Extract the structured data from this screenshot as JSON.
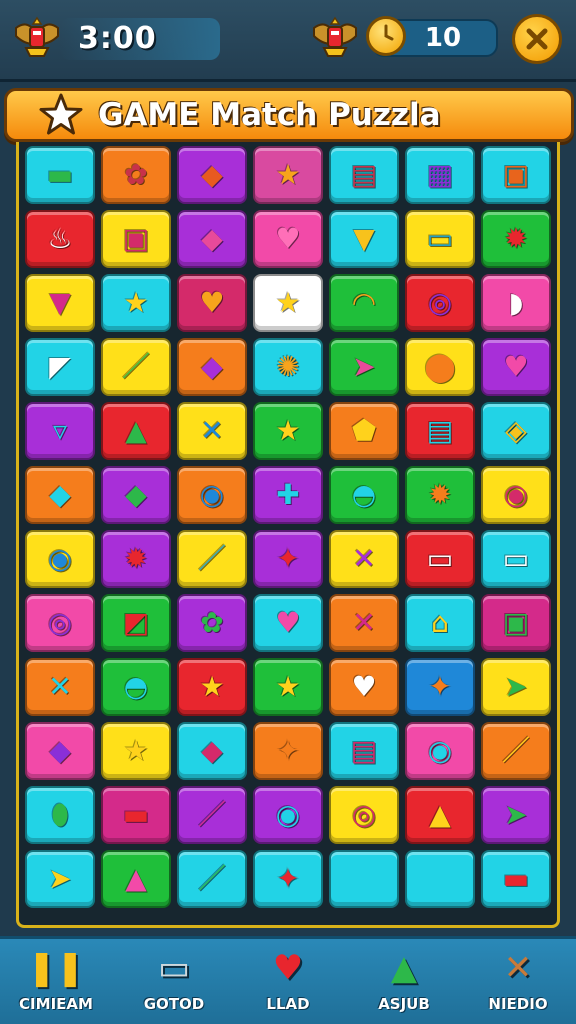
{
  "header": {
    "timer": "3:00",
    "score": "10",
    "title": "GAME Match Puzzla"
  },
  "icons": {
    "left_emblem": "eagle-crest-icon",
    "right_emblem": "eagle-crest-icon",
    "score_icon": "coin-clock-icon",
    "close": "close-x-icon",
    "banner_star": "star-icon"
  },
  "colors": {
    "banner": "#f7a31c",
    "board_border": "#d8b21a",
    "bottom_bar": "#2a89b8",
    "close_button": "#f5b014"
  },
  "board": {
    "rows": 12,
    "cols": 7,
    "tiles": [
      [
        {
          "bg": "#22d3e6",
          "icon": "▬",
          "fg": "#2db84a"
        },
        {
          "bg": "#f57d1c",
          "icon": "✿",
          "fg": "#c8324a"
        },
        {
          "bg": "#a82fd8",
          "icon": "◆",
          "fg": "#e85a20"
        },
        {
          "bg": "#d94aa0",
          "icon": "★",
          "fg": "#f7a41c"
        },
        {
          "bg": "#22d3e6",
          "icon": "▤",
          "fg": "#c8324a"
        },
        {
          "bg": "#22d3e6",
          "icon": "▦",
          "fg": "#8a2fd8"
        },
        {
          "bg": "#22d3e6",
          "icon": "▣",
          "fg": "#e8641c"
        }
      ],
      [
        {
          "bg": "#e8262e",
          "icon": "♨",
          "fg": "#ffffff"
        },
        {
          "bg": "#ffe019",
          "icon": "▣",
          "fg": "#d42a6a"
        },
        {
          "bg": "#a82fd8",
          "icon": "◆",
          "fg": "#e84a9a"
        },
        {
          "bg": "#f24aa8",
          "icon": "♥",
          "fg": "#ff6fb8"
        },
        {
          "bg": "#22d3e6",
          "icon": "▼",
          "fg": "#f7c21c"
        },
        {
          "bg": "#ffe019",
          "icon": "▭",
          "fg": "#1fa0c8"
        },
        {
          "bg": "#1fbf3a",
          "icon": "✹",
          "fg": "#e8262e"
        }
      ],
      [
        {
          "bg": "#ffe019",
          "icon": "▼",
          "fg": "#d42a8a"
        },
        {
          "bg": "#22d3e6",
          "icon": "★",
          "fg": "#ffd21c"
        },
        {
          "bg": "#d42a6a",
          "icon": "♥",
          "fg": "#f7a41c"
        },
        {
          "bg": "#ffffff",
          "icon": "★",
          "fg": "#ffd21c"
        },
        {
          "bg": "#1fbf3a",
          "icon": "◠",
          "fg": "#f7a41c"
        },
        {
          "bg": "#e8262e",
          "icon": "◎",
          "fg": "#8a2fd8"
        },
        {
          "bg": "#f24aa8",
          "icon": "◗",
          "fg": "#ffffff"
        }
      ],
      [
        {
          "bg": "#22d3e6",
          "icon": "◤",
          "fg": "#ffffff"
        },
        {
          "bg": "#ffe019",
          "icon": "／",
          "fg": "#2db84a"
        },
        {
          "bg": "#f57d1c",
          "icon": "◆",
          "fg": "#a82fd8"
        },
        {
          "bg": "#22d3e6",
          "icon": "✺",
          "fg": "#f7a41c"
        },
        {
          "bg": "#1fbf3a",
          "icon": "➤",
          "fg": "#e84a9a"
        },
        {
          "bg": "#ffe019",
          "icon": "⬤",
          "fg": "#f57d1c"
        },
        {
          "bg": "#a82fd8",
          "icon": "♥",
          "fg": "#f24aa8"
        }
      ],
      [
        {
          "bg": "#a82fd8",
          "icon": "▿",
          "fg": "#22d3e6"
        },
        {
          "bg": "#e8262e",
          "icon": "▲",
          "fg": "#2db84a"
        },
        {
          "bg": "#ffe019",
          "icon": "✕",
          "fg": "#1f88d8"
        },
        {
          "bg": "#1fbf3a",
          "icon": "★",
          "fg": "#ffd21c"
        },
        {
          "bg": "#f57d1c",
          "icon": "⬟",
          "fg": "#ffd21c"
        },
        {
          "bg": "#e8262e",
          "icon": "▤",
          "fg": "#22d3e6"
        },
        {
          "bg": "#22d3e6",
          "icon": "◈",
          "fg": "#f7c21c"
        }
      ],
      [
        {
          "bg": "#f57d1c",
          "icon": "◆",
          "fg": "#22d3e6"
        },
        {
          "bg": "#a82fd8",
          "icon": "◆",
          "fg": "#2db84a"
        },
        {
          "bg": "#f57d1c",
          "icon": "◉",
          "fg": "#1f88d8"
        },
        {
          "bg": "#a82fd8",
          "icon": "✚",
          "fg": "#22d3e6"
        },
        {
          "bg": "#1fbf3a",
          "icon": "◓",
          "fg": "#22d3e6"
        },
        {
          "bg": "#1fbf3a",
          "icon": "✹",
          "fg": "#f57d1c"
        },
        {
          "bg": "#ffe019",
          "icon": "◉",
          "fg": "#d42a6a"
        }
      ],
      [
        {
          "bg": "#ffe019",
          "icon": "◉",
          "fg": "#1f88d8"
        },
        {
          "bg": "#a82fd8",
          "icon": "✹",
          "fg": "#e8262e"
        },
        {
          "bg": "#ffe019",
          "icon": "／",
          "fg": "#1fa0c8"
        },
        {
          "bg": "#a82fd8",
          "icon": "✦",
          "fg": "#e8262e"
        },
        {
          "bg": "#ffe019",
          "icon": "✕",
          "fg": "#a82fd8"
        },
        {
          "bg": "#e8262e",
          "icon": "▭",
          "fg": "#ffffff"
        },
        {
          "bg": "#22d3e6",
          "icon": "▭",
          "fg": "#ffffff"
        }
      ],
      [
        {
          "bg": "#f24aa8",
          "icon": "◎",
          "fg": "#8a2fd8"
        },
        {
          "bg": "#1fbf3a",
          "icon": "◩",
          "fg": "#e8262e"
        },
        {
          "bg": "#a82fd8",
          "icon": "✿",
          "fg": "#2db84a"
        },
        {
          "bg": "#22d3e6",
          "icon": "♥",
          "fg": "#f24aa8"
        },
        {
          "bg": "#f57d1c",
          "icon": "✕",
          "fg": "#d42a8a"
        },
        {
          "bg": "#22d3e6",
          "icon": "⌂",
          "fg": "#ffd21c"
        },
        {
          "bg": "#d42a8a",
          "icon": "▣",
          "fg": "#2db84a"
        }
      ],
      [
        {
          "bg": "#f57d1c",
          "icon": "✕",
          "fg": "#22d3e6"
        },
        {
          "bg": "#1fbf3a",
          "icon": "◓",
          "fg": "#22d3e6"
        },
        {
          "bg": "#e8262e",
          "icon": "★",
          "fg": "#ffd21c"
        },
        {
          "bg": "#1fbf3a",
          "icon": "★",
          "fg": "#ffd21c"
        },
        {
          "bg": "#f57d1c",
          "icon": "♥",
          "fg": "#ffffff"
        },
        {
          "bg": "#1f88d8",
          "icon": "✦",
          "fg": "#f57d1c"
        },
        {
          "bg": "#ffe019",
          "icon": "➤",
          "fg": "#2db84a"
        }
      ],
      [
        {
          "bg": "#f24aa8",
          "icon": "◆",
          "fg": "#8a2fd8"
        },
        {
          "bg": "#ffe019",
          "icon": "★",
          "fg": "#ffd21c"
        },
        {
          "bg": "#22d3e6",
          "icon": "◆",
          "fg": "#d42a6a"
        },
        {
          "bg": "#f57d1c",
          "icon": "✦",
          "fg": "#f57d1c"
        },
        {
          "bg": "#22d3e6",
          "icon": "▤",
          "fg": "#d42a6a"
        },
        {
          "bg": "#f24aa8",
          "icon": "◉",
          "fg": "#22d3e6"
        },
        {
          "bg": "#f57d1c",
          "icon": "／",
          "fg": "#ffd21c"
        }
      ],
      [
        {
          "bg": "#22d3e6",
          "icon": "⬮",
          "fg": "#2db84a"
        },
        {
          "bg": "#d42a8a",
          "icon": "▬",
          "fg": "#e8262e"
        },
        {
          "bg": "#a82fd8",
          "icon": "／",
          "fg": "#d42a8a"
        },
        {
          "bg": "#a82fd8",
          "icon": "◉",
          "fg": "#22d3e6"
        },
        {
          "bg": "#ffe019",
          "icon": "◎",
          "fg": "#d42a6a"
        },
        {
          "bg": "#e8262e",
          "icon": "▲",
          "fg": "#ffd21c"
        },
        {
          "bg": "#a82fd8",
          "icon": "➤",
          "fg": "#2db84a"
        }
      ],
      [
        {
          "bg": "#22d3e6",
          "icon": "➤",
          "fg": "#ffd21c"
        },
        {
          "bg": "#1fbf3a",
          "icon": "▲",
          "fg": "#f24aa8"
        },
        {
          "bg": "#22d3e6",
          "icon": "／",
          "fg": "#2db84a"
        },
        {
          "bg": "#22d3e6",
          "icon": "✦",
          "fg": "#e8262e"
        },
        {
          "bg": "#22d3e6",
          "icon": "",
          "fg": "#22d3e6"
        },
        {
          "bg": "#22d3e6",
          "icon": "",
          "fg": "#22d3e6"
        },
        {
          "bg": "#22d3e6",
          "icon": "▬",
          "fg": "#e8262e"
        }
      ]
    ]
  },
  "bottom_nav": [
    {
      "label": "CIMIEAM",
      "icon": "pause-icon",
      "glyph": "❚❚",
      "color": "#f7c21c"
    },
    {
      "label": "GOTOD",
      "icon": "monitor-icon",
      "glyph": "▭",
      "color": "#cfd8dc"
    },
    {
      "label": "LLAD",
      "icon": "heart-icon",
      "glyph": "♥",
      "color": "#e8262e"
    },
    {
      "label": "ASJUB",
      "icon": "shape-bundle-icon",
      "glyph": "▲",
      "color": "#2db84a"
    },
    {
      "label": "NIEDIO",
      "icon": "crossed-tools-icon",
      "glyph": "✕",
      "color": "#c77a3a"
    }
  ]
}
